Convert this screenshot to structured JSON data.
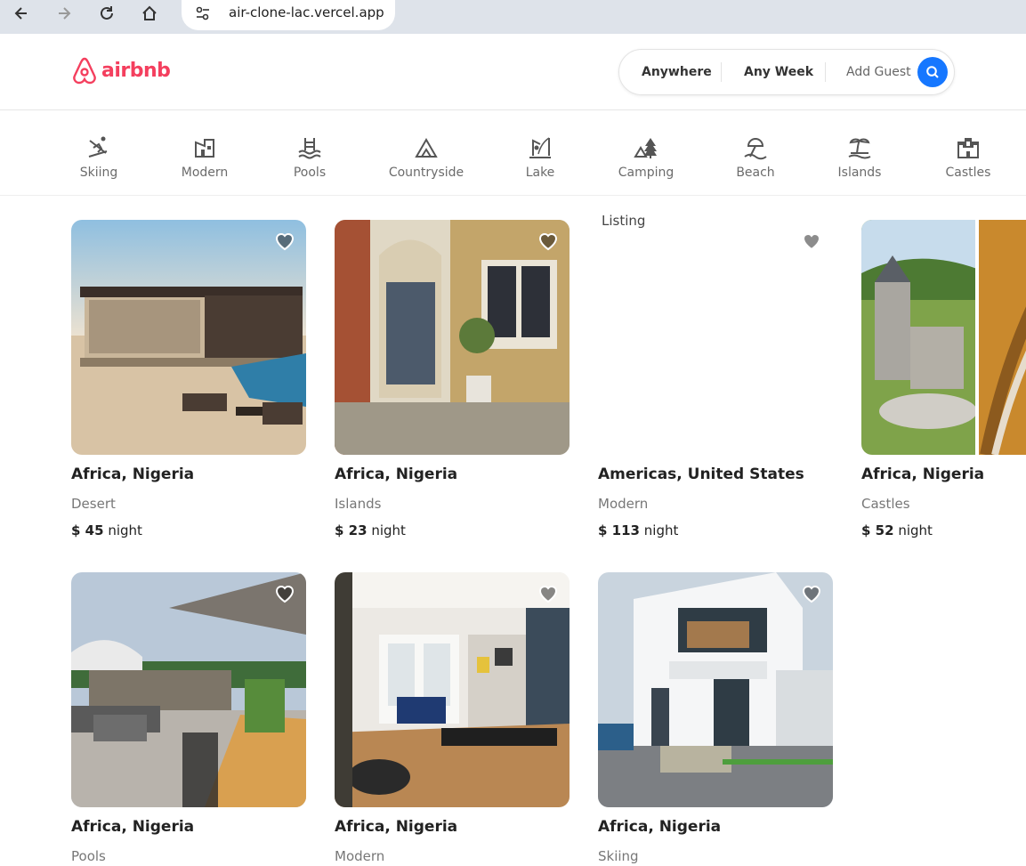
{
  "browser": {
    "url": "air-clone-lac.vercel.app"
  },
  "header": {
    "logo_text": "airbnb",
    "search": {
      "anywhere": "Anywhere",
      "week": "Any Week",
      "guest": "Add Guest"
    }
  },
  "categories": [
    {
      "label": "Skiing",
      "icon": "skiing-icon"
    },
    {
      "label": "Modern",
      "icon": "modern-icon"
    },
    {
      "label": "Pools",
      "icon": "pool-icon"
    },
    {
      "label": "Countryside",
      "icon": "countryside-icon"
    },
    {
      "label": "Lake",
      "icon": "lake-icon"
    },
    {
      "label": "Camping",
      "icon": "camping-icon"
    },
    {
      "label": "Beach",
      "icon": "beach-icon"
    },
    {
      "label": "Islands",
      "icon": "islands-icon"
    },
    {
      "label": "Castles",
      "icon": "castles-icon"
    }
  ],
  "listings": [
    {
      "location": "Africa, Nigeria",
      "category": "Desert",
      "price": "$ 45",
      "unit": "night"
    },
    {
      "location": "Africa, Nigeria",
      "category": "Islands",
      "price": "$ 23",
      "unit": "night"
    },
    {
      "location": "Americas, United States",
      "category": "Modern",
      "price": "$ 113",
      "unit": "night",
      "alt": "Listing"
    },
    {
      "location": "Africa, Nigeria",
      "category": "Castles",
      "price": "$ 52",
      "unit": "night"
    },
    {
      "location": "Africa, Nigeria",
      "category": "Pools"
    },
    {
      "location": "Africa, Nigeria",
      "category": "Modern"
    },
    {
      "location": "Africa, Nigeria",
      "category": "Skiing"
    }
  ]
}
